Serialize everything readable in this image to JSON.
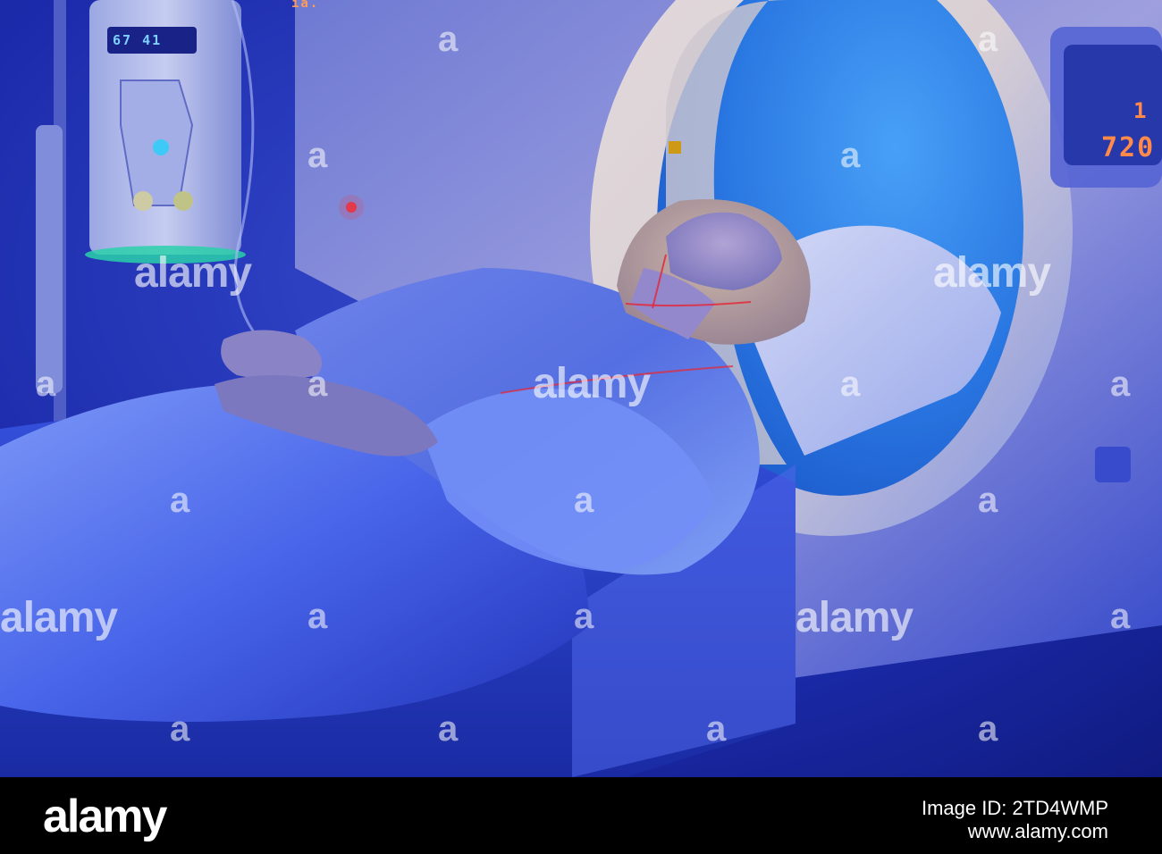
{
  "scene": {
    "description_icons": [
      "ct-scanner-icon",
      "iv-pump-icon",
      "patient-table-icon",
      "laser-line-icon"
    ],
    "colors": {
      "room_blue": "#1a2fb8",
      "bore_blue": "#2f8ee8",
      "laser_red": "#ff2a2a",
      "pump_glow": "#2ee6a8"
    },
    "pump_display": "67  41",
    "top_display": "ia.",
    "right_display_top": "1",
    "right_display_bottom": "720"
  },
  "watermark": {
    "text": "alamy",
    "a_glyph": "a"
  },
  "footer": {
    "logo": "alamy",
    "id_line1": "Image ID: 2TD4WMP",
    "id_line2": "www.alamy.com"
  }
}
